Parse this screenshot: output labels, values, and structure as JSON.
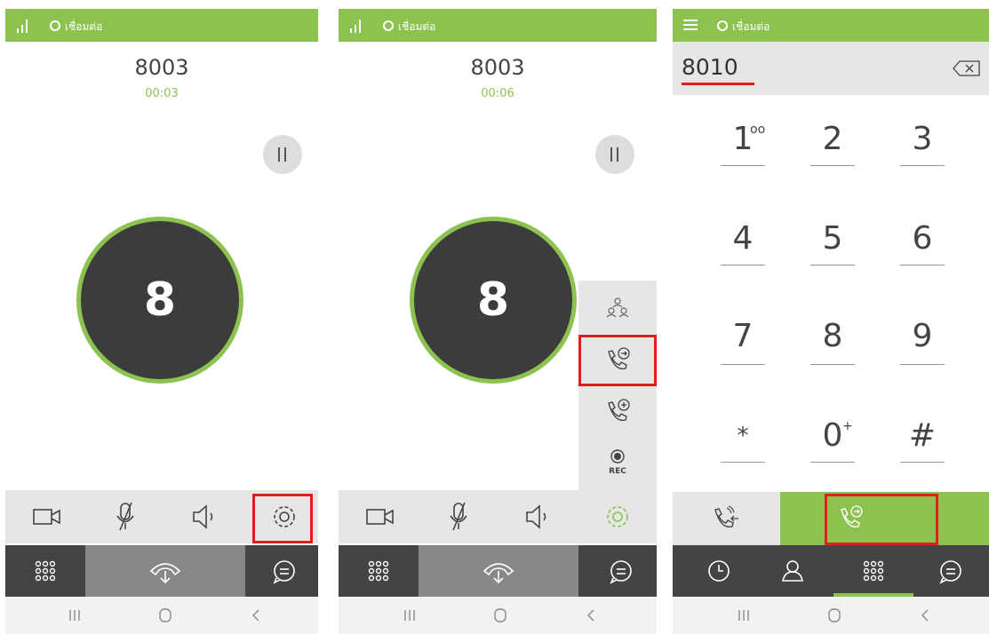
{
  "panels": [
    {
      "status": "เชื่อมต่อ",
      "number": "8003",
      "timer": "00:03",
      "avatar_letter": "8"
    },
    {
      "status": "เชื่อมต่อ",
      "number": "8003",
      "timer": "00:06",
      "avatar_letter": "8",
      "record_label": "REC"
    },
    {
      "status": "เชื่อมต่อ",
      "dial_value": "8010",
      "keys": [
        {
          "digit": "1",
          "sub": "oo"
        },
        {
          "digit": "2",
          "sub": ""
        },
        {
          "digit": "3",
          "sub": ""
        },
        {
          "digit": "4",
          "sub": ""
        },
        {
          "digit": "5",
          "sub": ""
        },
        {
          "digit": "6",
          "sub": ""
        },
        {
          "digit": "7",
          "sub": ""
        },
        {
          "digit": "8",
          "sub": ""
        },
        {
          "digit": "9",
          "sub": ""
        },
        {
          "digit": "*",
          "sub": ""
        },
        {
          "digit": "0",
          "sub": "+"
        },
        {
          "digit": "#",
          "sub": ""
        }
      ]
    }
  ],
  "colors": {
    "accent": "#8cc250",
    "highlight": "#e01e1e",
    "dark": "#444444",
    "avatar": "#3c3c3c"
  },
  "icons": [
    "signal-icon",
    "menu-icon",
    "pause-icon",
    "video-icon",
    "mute-icon",
    "speaker-icon",
    "settings-icon",
    "keypad-icon",
    "hangup-icon",
    "chat-icon",
    "conference-icon",
    "transfer-icon",
    "add-call-icon",
    "record-icon",
    "backspace-icon",
    "call-log-icon",
    "contacts-icon",
    "recents-nav-icon",
    "home-nav-icon",
    "back-nav-icon"
  ]
}
